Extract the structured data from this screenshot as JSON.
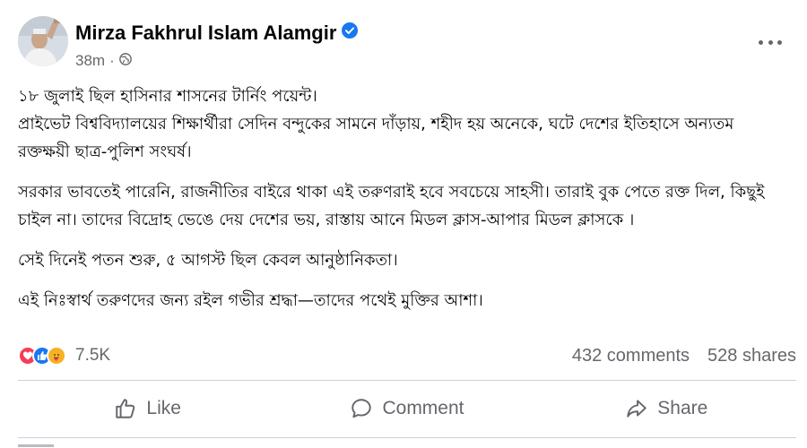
{
  "post": {
    "author": "Mirza Fakhrul Islam Alamgir",
    "verified_icon": "verified-badge-icon",
    "time": "38m",
    "audience_icon": "globe-icon",
    "more_icon": "more-options-icon",
    "paragraphs": [
      "১৮ জুলাই ছিল হাসিনার শাসনের টার্নিং পয়েন্ট।\nপ্রাইভেট বিশ্ববিদ্যালয়ের শিক্ষার্থীরা সেদিন বন্দুকের সামনে দাঁড়ায়, শহীদ হয় অনেকে, ঘটে দেশের ইতিহাসে অন্যতম রক্তক্ষয়ী ছাত্র-পুলিশ সংঘর্ষ।",
      "সরকার ভাবতেই পারেনি, রাজনীতির বাইরে থাকা এই তরুণরাই হবে সবচেয়ে সাহসী। তারাই বুক পেতে রক্ত দিল, কিছুই চাইল না। তাদের বিদ্রোহ ভেঙে দেয় দেশের ভয়, রাস্তায় আনে মিডল ক্লাস-আপার মিডল ক্লাসকে ।",
      "সেই দিনেই পতন শুরু, ৫ আগস্ট ছিল কেবল আনুষ্ঠানিকতা।",
      "এই নিঃস্বার্থ তরুণদের জন্য রইল গভীর শ্রদ্ধা—তাদের পথেই মুক্তির আশা।"
    ]
  },
  "stats": {
    "reactions_count": "7.5K",
    "comments": "432 comments",
    "shares": "528 shares",
    "reaction_icons": [
      "love-icon",
      "like-icon",
      "care-icon"
    ]
  },
  "actions": {
    "like": "Like",
    "comment": "Comment",
    "share": "Share"
  },
  "colors": {
    "text": "#050505",
    "secondary": "#65676b",
    "brand_blue": "#1877f2",
    "love_red": "#f33e58",
    "care_yellow": "#f7b125",
    "divider": "#ced0d4"
  }
}
